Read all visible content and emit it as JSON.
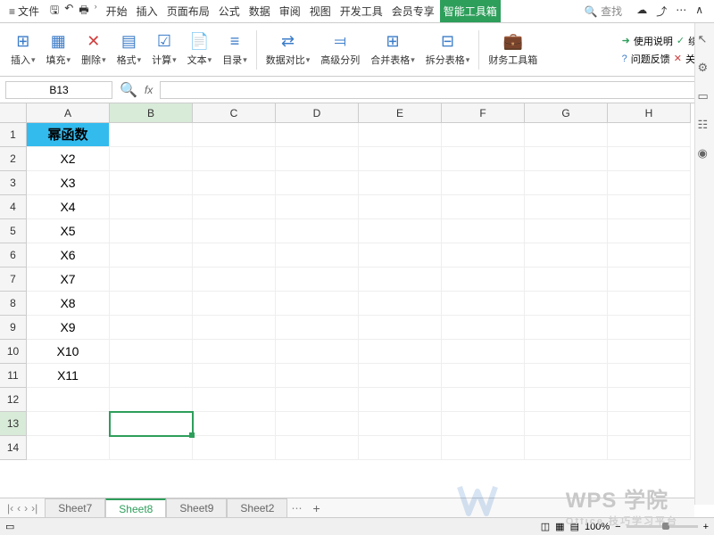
{
  "menu": {
    "file": "文件",
    "tabs": [
      "开始",
      "插入",
      "页面布局",
      "公式",
      "数据",
      "审阅",
      "视图",
      "开发工具",
      "会员专享",
      "智能工具箱"
    ],
    "active_tab_index": 9,
    "search": "查找"
  },
  "ribbon": {
    "items": [
      {
        "icon": "⊞",
        "label": "插入"
      },
      {
        "icon": "▦",
        "label": "填充"
      },
      {
        "icon": "✕",
        "label": "删除"
      },
      {
        "icon": "▤",
        "label": "格式"
      },
      {
        "icon": "∑",
        "label": "计算"
      },
      {
        "icon": "Aa",
        "label": "文本"
      },
      {
        "icon": "≡",
        "label": "目录"
      },
      {
        "icon": "⇄",
        "label": "数据对比"
      },
      {
        "icon": "⫤",
        "label": "高级分列"
      },
      {
        "icon": "⊞",
        "label": "合并表格"
      },
      {
        "icon": "⊟",
        "label": "拆分表格"
      },
      {
        "icon": "💼",
        "label": "财务工具箱"
      }
    ],
    "right": {
      "help": "使用说明",
      "renew": "续",
      "feedback": "问题反馈",
      "close": "关闭"
    }
  },
  "formula": {
    "cell_ref": "B13",
    "fx": "fx",
    "value": ""
  },
  "sheet": {
    "columns": [
      "A",
      "B",
      "C",
      "D",
      "E",
      "F",
      "G",
      "H"
    ],
    "rows": [
      1,
      2,
      3,
      4,
      5,
      6,
      7,
      8,
      9,
      10,
      11,
      12,
      13,
      14
    ],
    "selected_col": 1,
    "selected_row": 12,
    "data": {
      "A1": "幂函数",
      "A2": "X2",
      "A3": "X3",
      "A4": "X4",
      "A5": "X5",
      "A6": "X6",
      "A7": "X7",
      "A8": "X8",
      "A9": "X9",
      "A10": "X10",
      "A11": "X11"
    }
  },
  "tabs": {
    "list": [
      "Sheet7",
      "Sheet8",
      "Sheet9",
      "Sheet2"
    ],
    "active": 1
  },
  "status": {
    "zoom": "100%"
  },
  "watermark": {
    "main": "WPS 学院",
    "sub": "Office 技巧学习平台"
  }
}
